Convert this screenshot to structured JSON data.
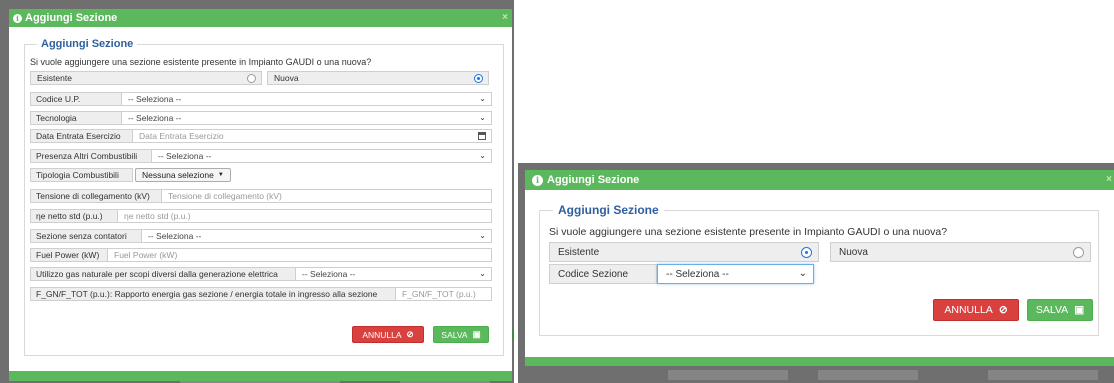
{
  "left_dialog": {
    "title": "Aggiungi Sezione",
    "close": "×",
    "section_title": "Aggiungi Sezione",
    "question": "Si vuole aggiungere una sezione esistente presente in Impianto GAUDI o una nuova?",
    "option_existing": "Esistente",
    "option_new": "Nuova",
    "selected_option": "Nuova",
    "fields": {
      "codice_up": {
        "label": "Codice U.P.",
        "value": "-- Seleziona --"
      },
      "tecnologia": {
        "label": "Tecnologia",
        "value": "-- Seleziona --"
      },
      "data_entrata": {
        "label": "Data Entrata Esercizio",
        "placeholder": "Data Entrata Esercizio"
      },
      "altri_combustibili": {
        "label": "Presenza Altri Combustibili",
        "value": "-- Seleziona --"
      },
      "tipologia_combustibili": {
        "label": "Tipologia Combustibili",
        "value": "Nessuna selezione"
      },
      "tensione": {
        "label": "Tensione di collegamento (kV)",
        "placeholder": "Tensione di collegamento (kV)"
      },
      "eta_netto": {
        "label": "ηe netto std (p.u.)",
        "placeholder": "ηe netto std (p.u.)"
      },
      "senza_contatori": {
        "label": "Sezione senza contatori",
        "value": "-- Seleziona --"
      },
      "fuel_power": {
        "label": "Fuel Power (kW)",
        "placeholder": "Fuel Power (kW)"
      },
      "gas_naturale": {
        "label": "Utilizzo gas naturale per scopi diversi dalla generazione elettrica",
        "value": "-- Seleziona --"
      },
      "rapporto_energia": {
        "label": "F_GN/F_TOT (p.u.): Rapporto energia gas sezione / energia totale in ingresso alla sezione",
        "placeholder": "F_GN/F_TOT (p.u.)"
      }
    },
    "cancel_label": "ANNULLA",
    "save_label": "SALVA"
  },
  "right_dialog": {
    "title": "Aggiungi Sezione",
    "close": "×",
    "section_title": "Aggiungi Sezione",
    "question": "Si vuole aggiungere una sezione esistente presente in Impianto GAUDI o una nuova?",
    "option_existing": "Esistente",
    "option_new": "Nuova",
    "selected_option": "Esistente",
    "codice_sezione": {
      "label": "Codice Sezione",
      "value": "-- Seleziona --"
    },
    "cancel_label": "ANNULLA",
    "save_label": "SALVA"
  },
  "colors": {
    "header_green": "#5cb85c",
    "legend_blue": "#2f5f9e",
    "danger_red": "#d9413e",
    "radio_blue": "#1a73e8",
    "backdrop_gray": "#6f6f6f"
  },
  "icons": [
    "info-icon",
    "close-icon",
    "chevron-down-icon",
    "calendar-icon",
    "caret-down-icon",
    "ban-icon",
    "save-icon",
    "radio-icon"
  ]
}
